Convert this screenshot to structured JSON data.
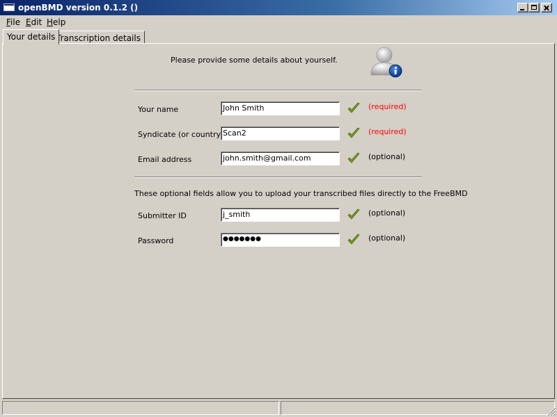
{
  "window": {
    "title": "openBMD version 0.1.2 ()"
  },
  "menu": {
    "file": "File",
    "edit": "Edit",
    "help": "Help"
  },
  "tabs": [
    "Your details",
    "Transcription details"
  ],
  "intro": "Please provide some details about yourself.",
  "fields": [
    {
      "label": "Your name",
      "value": "John Smith",
      "note": "(required)"
    },
    {
      "label": "Syndicate (or country)",
      "value": "Scan2",
      "note": "(required)"
    },
    {
      "label": "Email address",
      "value": "john.smith@gmail.com",
      "note": "(optional)"
    }
  ],
  "optional_hint": "These optional fields allow you to upload your transcribed files directly to the FreeBMD",
  "upload_fields": [
    {
      "label": "Submitter ID",
      "value": "j_smith",
      "note": "(optional)"
    },
    {
      "label": "Password",
      "value": "●●●●●●●",
      "note": "(optional)"
    }
  ],
  "colors": {
    "required": "#ff0000",
    "check": "#7a9a1e",
    "title_start": "#0a246a",
    "title_end": "#a6caf0"
  },
  "icons": {
    "user_info": "user-info-icon",
    "check": "checkmark-icon"
  }
}
